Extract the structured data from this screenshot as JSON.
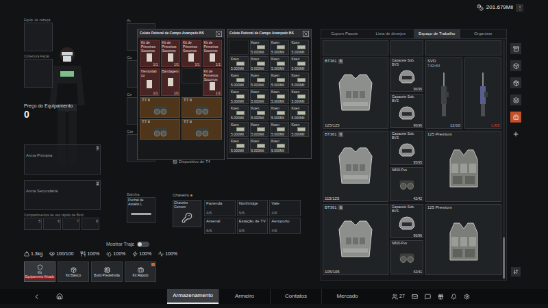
{
  "top_bar": {
    "currency": "201.679Mil",
    "menu": "⋮"
  },
  "equipment": {
    "head": "Equip. de cabeça",
    "face": "Cobertura Facial",
    "price_label": "Preço do Equipamento",
    "price": "0",
    "weapons": [
      {
        "label": "Arma Primária",
        "key": "1"
      },
      {
        "label": "Arma Secundária",
        "key": "2"
      }
    ],
    "quick_label": "Compartimentos de uso rápido de Bind",
    "quick_keys": [
      "5",
      "6",
      "7",
      "8"
    ],
    "side_slots": [
      {
        "label": "Ar"
      },
      {
        "label": "Co"
      },
      {
        "label": "Ce"
      },
      {
        "label": "Car"
      }
    ],
    "sheath": {
      "label": "Bainha",
      "item": "Punhal de Assalto L"
    },
    "show_outfit": {
      "label": "Mostrar Traje",
      "on": false
    }
  },
  "stats": [
    {
      "value": "1.3kg"
    },
    {
      "value": "100/100"
    },
    {
      "value": "100%"
    },
    {
      "value": "100%"
    },
    {
      "value": "100%"
    },
    {
      "value": "100%"
    }
  ],
  "kits": [
    {
      "label": "Kit",
      "sub": "Equipamento Ativado",
      "selected": true,
      "badge": false
    },
    {
      "label": "Kit Básico",
      "sub": "",
      "selected": false,
      "badge": false
    },
    {
      "label": "Build Predefinida",
      "sub": "",
      "selected": false,
      "badge": false
    },
    {
      "label": "Kit Rápido",
      "sub": "",
      "selected": false,
      "badge": true
    }
  ],
  "device": "Dispositivo de T4",
  "keychain": {
    "label": "Chaveiro",
    "item": "Chaveiro Comum",
    "keys": [
      {
        "name": "Fazenda",
        "count": "4/6"
      },
      {
        "name": "Northridge",
        "count": "5/6"
      },
      {
        "name": "Vale",
        "count": "4/6"
      },
      {
        "name": "Arsenal",
        "count": "6/6"
      },
      {
        "name": "Estação de TV",
        "count": "0/6"
      },
      {
        "name": "Aeroporto",
        "count": "4/6"
      }
    ]
  },
  "popups": [
    {
      "title": "Colete Peitoral de Campo Avançado BS",
      "items": [
        {
          "kind": "med",
          "name": "Kit de Primeiros Socorros",
          "count": "1/1"
        },
        {
          "kind": "med",
          "name": "Kit de Primeiros Socorros",
          "count": "1/1"
        },
        {
          "kind": "med",
          "name": "Kit de Primeiros Socorros",
          "count": "1/1"
        },
        {
          "kind": "med",
          "name": "Kit de Primeiros Socorros",
          "count": "1/1"
        },
        {
          "kind": "med",
          "name": "Hemostático",
          "count": "1/1"
        },
        {
          "kind": "med",
          "name": "Bandagem",
          "count": "1/1"
        },
        {
          "kind": "empty",
          "name": "",
          "count": ""
        },
        {
          "kind": "med",
          "name": "Kit de Primeiros Socorros",
          "count": "1/1"
        },
        {
          "kind": "nvg",
          "name": "T7 II",
          "count": ""
        },
        {
          "kind": "nvg",
          "name": "T7 II",
          "count": ""
        },
        {
          "kind": "nvg",
          "name": "T7 II",
          "count": ""
        },
        {
          "kind": "nvg",
          "name": "T7 II",
          "count": ""
        }
      ]
    },
    {
      "title": "Colete Peitoral de Campo Avançado BS",
      "items": [
        {
          "kind": "empty",
          "name": "",
          "count": ""
        },
        {
          "kind": "money",
          "name": "Koen",
          "count": "5.000Mil"
        },
        {
          "kind": "money",
          "name": "Koen",
          "count": "5.000Mil"
        },
        {
          "kind": "money",
          "name": "Koen",
          "count": "5.000Mil"
        },
        {
          "kind": "money",
          "name": "Koen",
          "count": "5.000Mil"
        },
        {
          "kind": "money",
          "name": "Koen",
          "count": "5.000Mil"
        },
        {
          "kind": "money",
          "name": "Koen",
          "count": "5.000Mil"
        },
        {
          "kind": "money",
          "name": "Koen",
          "count": "5.000Mil"
        },
        {
          "kind": "money",
          "name": "Koen",
          "count": "5.000Mil"
        },
        {
          "kind": "money",
          "name": "Koen",
          "count": "5.000Mil"
        },
        {
          "kind": "money",
          "name": "Koen",
          "count": "5.000Mil"
        },
        {
          "kind": "money",
          "name": "Koen",
          "count": "5.000Mil"
        },
        {
          "kind": "money",
          "name": "Koen",
          "count": "5.000Mil"
        },
        {
          "kind": "money",
          "name": "Koen",
          "count": "5.000Mil"
        },
        {
          "kind": "money",
          "name": "Koen",
          "count": "5.000Mil"
        },
        {
          "kind": "money",
          "name": "Koen",
          "count": "5.000Mil"
        },
        {
          "kind": "money",
          "name": "Koen",
          "count": "5.000Mil"
        },
        {
          "kind": "money",
          "name": "Koen",
          "count": "5.000Mil"
        },
        {
          "kind": "money",
          "name": "Koen",
          "count": "5.000Mil"
        },
        {
          "kind": "money",
          "name": "Koen",
          "count": "5.000Mil"
        },
        {
          "kind": "money",
          "name": "Koen",
          "count": "5.000Mil"
        },
        {
          "kind": "money",
          "name": "Koen",
          "count": "5.000Mil"
        },
        {
          "kind": "money",
          "name": "Koen",
          "count": "5.000Mil"
        },
        {
          "kind": "money",
          "name": "Koen",
          "count": "5.000Mil"
        },
        {
          "kind": "money",
          "name": "Koen",
          "count": "5.000Mil"
        },
        {
          "kind": "money",
          "name": "Koen",
          "count": "5.000Mil"
        },
        {
          "kind": "money",
          "name": "Koen",
          "count": "5.000Mil"
        }
      ]
    }
  ],
  "storage": {
    "tabs": [
      {
        "label": "Cupom Pacote",
        "selected": false
      },
      {
        "label": "Lista de desejos",
        "selected": false
      },
      {
        "label": "Espaço de Trabalho",
        "selected": true
      },
      {
        "label": "Organizar",
        "selected": false
      }
    ],
    "rows": [
      {
        "armor": {
          "name": "BT361",
          "tier": "6",
          "durability": "125/125"
        },
        "column": [
          {
            "kind": "helmet",
            "name": "Capacete Sob. BVS",
            "durability": "96/96"
          },
          {
            "kind": "helmet",
            "name": "Capacete Sob. BVS",
            "durability": "96/96"
          }
        ],
        "extra": {
          "kind": "rifles",
          "items": [
            {
              "name": "SVD",
              "caliber": "7.62×54",
              "durability": "12/10",
              "low": false
            },
            {
              "name": "",
              "caliber": "",
              "durability": "L/63",
              "low": true
            }
          ]
        }
      },
      {
        "armor": {
          "name": "BT361",
          "tier": "6",
          "durability": "115/125"
        },
        "column": [
          {
            "kind": "helmet",
            "name": "Capacete Sob. BVS",
            "durability": "95/95"
          },
          {
            "kind": "nvg",
            "name": "N800-Pvs",
            "durability": "42/42"
          }
        ],
        "extra": {
          "kind": "rig",
          "name": "125 Premium"
        }
      },
      {
        "armor": {
          "name": "BT361",
          "tier": "6",
          "durability": "105/105"
        },
        "column": [
          {
            "kind": "helmet",
            "name": "Capacete Sob. BVS",
            "durability": "96/96"
          },
          {
            "kind": "nvg",
            "name": "N800-Pvs",
            "durability": "42/41"
          }
        ],
        "extra": {
          "kind": "rig",
          "name": "125 Premium"
        }
      }
    ]
  },
  "sidebar": [
    {
      "selected": false
    },
    {
      "selected": false
    },
    {
      "selected": false
    },
    {
      "selected": false
    },
    {
      "selected": true
    }
  ],
  "bottom_nav": {
    "tabs": [
      {
        "label": "Armazenamento",
        "selected": true
      },
      {
        "label": "Armeiro",
        "selected": false
      },
      {
        "label": "Contatos",
        "selected": false
      },
      {
        "label": "Mercado",
        "selected": false
      }
    ],
    "friends_count": "27"
  }
}
